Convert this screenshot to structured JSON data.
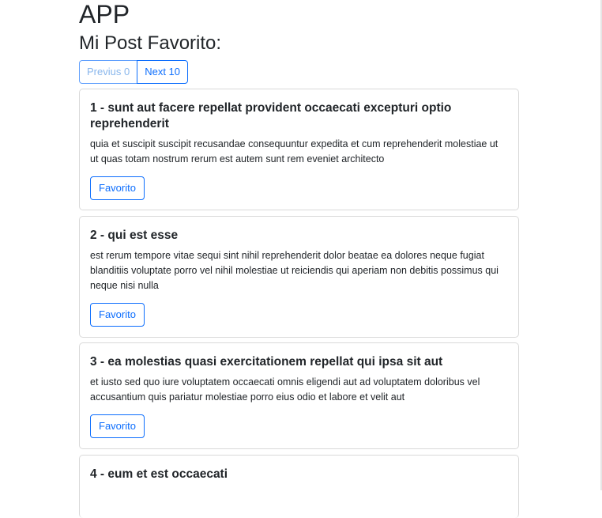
{
  "app": {
    "title": "APP",
    "section_title": "Mi Post Favorito:"
  },
  "pager": {
    "prev_label": "Previus 0",
    "next_label": "Next 10"
  },
  "posts": [
    {
      "title": "1 - sunt aut facere repellat provident occaecati excepturi optio reprehenderit",
      "body": "quia et suscipit suscipit recusandae consequuntur expedita et cum reprehenderit molestiae ut ut quas totam nostrum rerum est autem sunt rem eveniet architecto",
      "button_label": "Favorito"
    },
    {
      "title": "2 - qui est esse",
      "body": "est rerum tempore vitae sequi sint nihil reprehenderit dolor beatae ea dolores neque fugiat blanditiis voluptate porro vel nihil molestiae ut reiciendis qui aperiam non debitis possimus qui neque nisi nulla",
      "button_label": "Favorito"
    },
    {
      "title": "3 - ea molestias quasi exercitationem repellat qui ipsa sit aut",
      "body": "et iusto sed quo iure voluptatem occaecati omnis eligendi aut ad voluptatem doloribus vel accusantium quis pariatur molestiae porro eius odio et labore et velit aut",
      "button_label": "Favorito"
    },
    {
      "title": "4 - eum et est occaecati",
      "body": "",
      "button_label": ""
    }
  ],
  "colors": {
    "primary": "#0d6efd",
    "card_border": "#d9d9d9",
    "text": "#212529"
  }
}
